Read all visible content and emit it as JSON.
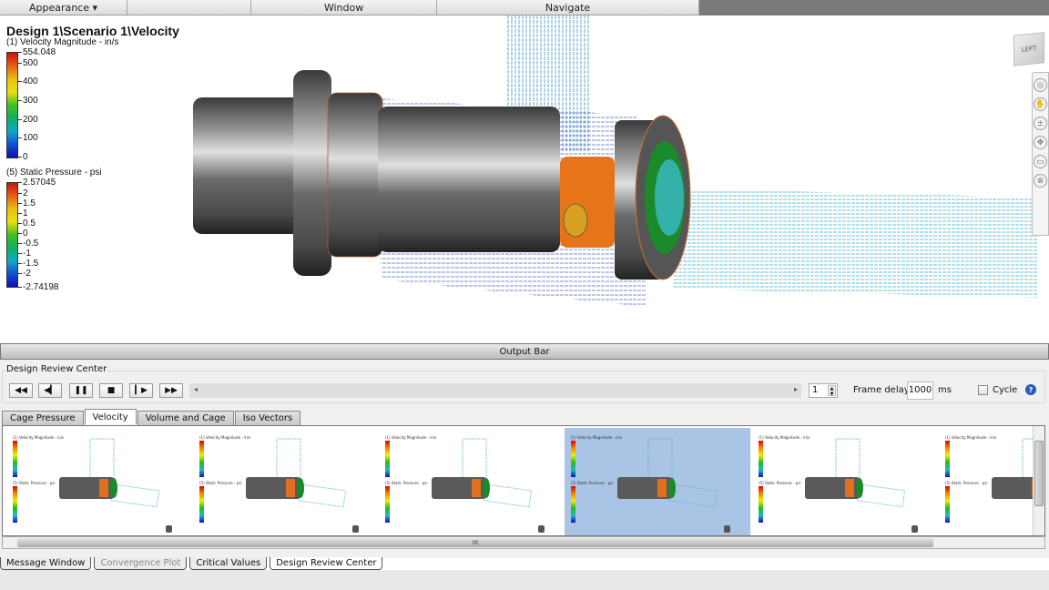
{
  "menubar": {
    "items": [
      {
        "label": "Appearance ▾"
      },
      {
        "label": "Window"
      },
      {
        "label": "Navigate"
      }
    ]
  },
  "viewport": {
    "title": "Design 1\\Scenario 1\\Velocity",
    "view_cube_label": "LEFT",
    "legends": [
      {
        "title": "(1) Velocity Magnitude - in/s",
        "labels": [
          "554.048",
          "500",
          "400",
          "300",
          "200",
          "100",
          "0"
        ]
      },
      {
        "title": "(5) Static Pressure - psi",
        "labels": [
          "2.57045",
          "2",
          "1.5",
          "1",
          "0.5",
          "0",
          "-0.5",
          "-1",
          "-1.5",
          "-2",
          "-2.74198"
        ]
      }
    ]
  },
  "output_bar": {
    "label": "Output Bar"
  },
  "design_review_center": {
    "label": "Design Review Center",
    "playback": {
      "buttons": [
        {
          "name": "rewind",
          "glyph": "◀◀"
        },
        {
          "name": "step-back",
          "glyph": "◀▎"
        },
        {
          "name": "pause",
          "glyph": "❚❚"
        },
        {
          "name": "stop",
          "glyph": "■"
        },
        {
          "name": "step-forward",
          "glyph": "▎▶"
        },
        {
          "name": "fast-forward",
          "glyph": "▶▶"
        }
      ],
      "slider_left_arrow": "◂",
      "slider_right_arrow": "▸",
      "frame_value": "1",
      "frame_delay_label": "Frame delay:",
      "frame_delay_value": "1000",
      "frame_delay_unit": "ms",
      "cycle_label": "Cycle",
      "cycle_checked": false,
      "help": "?"
    },
    "tabs": [
      {
        "label": "Cage Pressure",
        "active": false
      },
      {
        "label": "Velocity",
        "active": true
      },
      {
        "label": "Volume and Cage",
        "active": false
      },
      {
        "label": "Iso Vectors",
        "active": false
      }
    ],
    "thumbnails": [
      {
        "vel_title": "(1) Velocity Magnitude - in/s",
        "press_title": "(5) Static Pressure - psi",
        "selected": false
      },
      {
        "vel_title": "(1) Velocity Magnitude - in/s",
        "press_title": "(5) Static Pressure - psi",
        "selected": false
      },
      {
        "vel_title": "(1) Velocity Magnitude - in/s",
        "press_title": "(5) Static Pressure - psi",
        "selected": false
      },
      {
        "vel_title": "(1) Velocity Magnitude - in/s",
        "press_title": "(5) Static Pressure - psi",
        "selected": true
      },
      {
        "vel_title": "(1) Velocity Magnitude - in/s",
        "press_title": "(5) Static Pressure - psi",
        "selected": false
      },
      {
        "vel_title": "(1) Velocity Magnitude - in/s",
        "press_title": "(5) Static Pressure - psi",
        "selected": false
      }
    ],
    "hscroll_grip": "III"
  },
  "bottom_tabs": [
    {
      "label": "Message Window",
      "state": "normal"
    },
    {
      "label": "Convergence Plot",
      "state": "dim"
    },
    {
      "label": "Critical Values",
      "state": "normal"
    },
    {
      "label": "Design Review Center",
      "state": "active"
    }
  ],
  "colors": {
    "accent_selection": "#a9c4e4",
    "help_icon": "#2a5db8",
    "flange_orange": "#e8741a",
    "vector_blue": "#1a2a9a",
    "vector_cyan": "#3ab0c8"
  }
}
